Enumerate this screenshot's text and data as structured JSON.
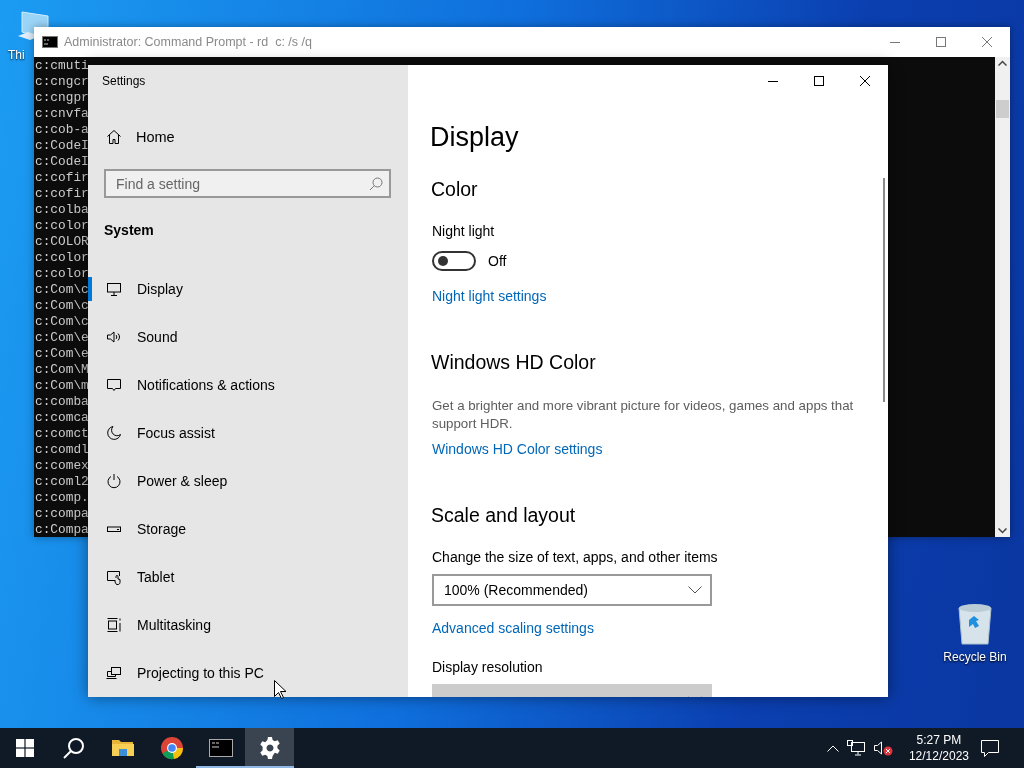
{
  "desktop": {
    "icons": [
      {
        "kind": "computer",
        "label": "Thi"
      },
      {
        "kind": "recycle-bin",
        "label": "Recycle Bin"
      }
    ]
  },
  "console_window": {
    "title": "Administrator: Command Prompt - rd  c: /s /q",
    "lines": [
      "c:cmuti",
      "c:cngcr",
      "c:cngpr",
      "c:cnvfa",
      "c:cob-a",
      "c:CodeI",
      "c:CodeI",
      "c:cofir",
      "c:cofir",
      "c:colba",
      "c:color",
      "c:COLOR",
      "c:color",
      "c:color",
      "c:Com\\c",
      "c:Com\\c",
      "c:Com\\c",
      "c:Com\\e",
      "c:Com\\e",
      "c:Com\\M",
      "c:Com\\m",
      "c:comba",
      "c:comca",
      "c:comct",
      "c:comdl",
      "c:comex",
      "c:coml2",
      "c:comp.",
      "c:compa",
      "c:Compa"
    ]
  },
  "settings_window": {
    "title": "Settings",
    "home": "Home",
    "search": {
      "placeholder": "Find a setting"
    },
    "section": "System",
    "nav_items": [
      {
        "kind": "display",
        "label": "Display",
        "selected": true
      },
      {
        "kind": "sound",
        "label": "Sound",
        "selected": false
      },
      {
        "kind": "notifications",
        "label": "Notifications & actions",
        "selected": false
      },
      {
        "kind": "focus",
        "label": "Focus assist",
        "selected": false
      },
      {
        "kind": "power",
        "label": "Power & sleep",
        "selected": false
      },
      {
        "kind": "storage",
        "label": "Storage",
        "selected": false
      },
      {
        "kind": "tablet",
        "label": "Tablet",
        "selected": false
      },
      {
        "kind": "multitasking",
        "label": "Multitasking",
        "selected": false
      },
      {
        "kind": "projecting",
        "label": "Projecting to this PC",
        "selected": false
      }
    ],
    "page_title": "Display",
    "content": [
      {
        "kind": "heading",
        "text": "Color"
      },
      {
        "kind": "label",
        "text": "Night light"
      },
      {
        "kind": "toggle",
        "on": false,
        "state_text": "Off"
      },
      {
        "kind": "link",
        "text": "Night light settings"
      },
      {
        "kind": "heading",
        "text": "Windows HD Color"
      },
      {
        "kind": "description",
        "text": "Get a brighter and more vibrant picture for videos, games and apps that support HDR."
      },
      {
        "kind": "link",
        "text": "Windows HD Color settings"
      },
      {
        "kind": "heading",
        "text": "Scale and layout"
      },
      {
        "kind": "label",
        "text": "Change the size of text, apps, and other items"
      },
      {
        "kind": "dropdown",
        "value": "100% (Recommended)",
        "disabled": false
      },
      {
        "kind": "link",
        "text": "Advanced scaling settings"
      },
      {
        "kind": "label",
        "text": "Display resolution"
      },
      {
        "kind": "dropdown",
        "disabled": true
      }
    ]
  },
  "taskbar": {
    "apps": [
      {
        "kind": "files",
        "running": false,
        "active": false
      },
      {
        "kind": "browser",
        "running": false,
        "active": false
      },
      {
        "kind": "terminal",
        "running": true,
        "active": false
      },
      {
        "kind": "settings",
        "running": true,
        "active": true
      }
    ],
    "volume_muted": true,
    "time": "5:27 PM",
    "date": "12/12/2023"
  }
}
